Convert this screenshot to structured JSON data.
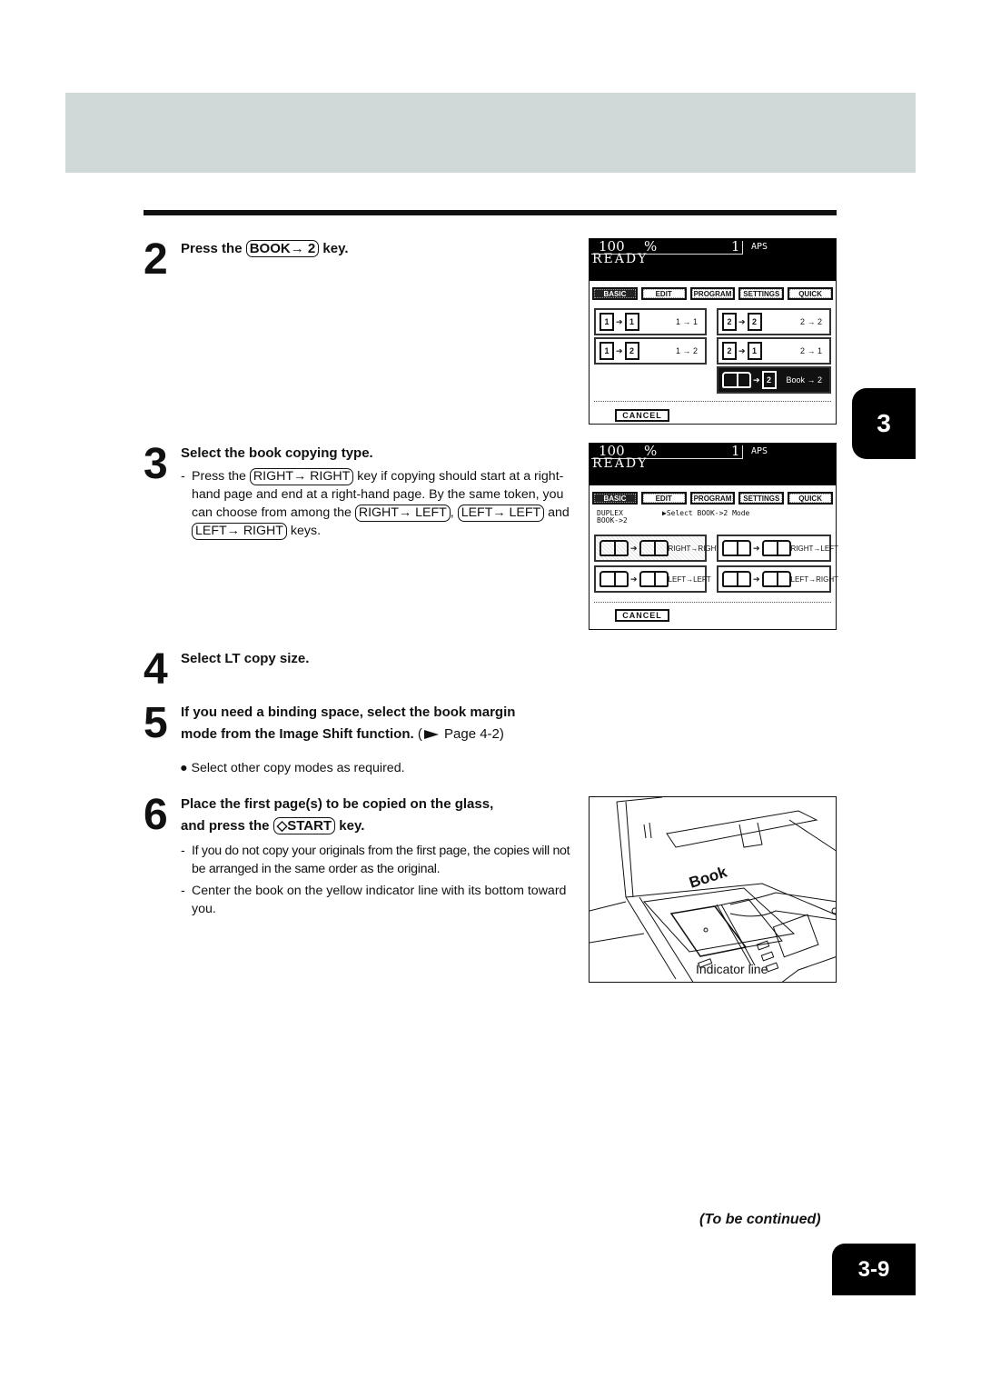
{
  "chapter_tab": "3",
  "steps": {
    "s2": {
      "num": "2",
      "title_pre": "Press the",
      "key": "BOOK→ 2",
      "title_post": "key."
    },
    "s3": {
      "num": "3",
      "title": "Select the book copying type.",
      "body_pre": "Press the",
      "key1": "RIGHT→ RIGHT",
      "body_mid1": "key if copying should start at a right-hand page and end at a right-hand page. By the same token, you can choose from among the",
      "key2": "RIGHT→ LEFT",
      "comma": ",",
      "key3": "LEFT→ LEFT",
      "and": "and",
      "key4": "LEFT→ RIGHT",
      "body_end": "keys."
    },
    "s4": {
      "num": "4",
      "title": "Select LT copy size."
    },
    "s5": {
      "num": "5",
      "title_line1": "If you need a binding space, select the book margin",
      "title_line2": "mode from the Image Shift function.",
      "ref_pre": "(",
      "ref": "Page 4-2)",
      "bullet": "Select other copy modes as required."
    },
    "s6": {
      "num": "6",
      "title_line1": "Place the first page(s) to be copied on the glass,",
      "title_pre": "and press the",
      "key": "◇START",
      "title_post": "key.",
      "notes": [
        "If you do not copy your originals from the first page, the copies will not be arranged in the same order as the original.",
        "Center the book on the yellow indicator line with its bottom toward you."
      ]
    }
  },
  "panel1": {
    "zoom": "100",
    "pct": "%",
    "copies": "1",
    "aps": "APS",
    "status": "READY",
    "tabs": [
      "BASIC",
      "EDIT",
      "PROGRAM",
      "SETTINGS",
      "QUICK"
    ],
    "active_tab": "BASIC",
    "modes": [
      {
        "from": "1",
        "to": "1",
        "label": "1 → 1"
      },
      {
        "from": "2",
        "to": "2",
        "label": "2 → 2"
      },
      {
        "from": "1",
        "to": "2",
        "label": "1 → 2"
      },
      {
        "from": "2",
        "to": "1",
        "label": "2 → 1"
      },
      {
        "from": "book",
        "to": "2",
        "label": "Book → 2",
        "selected": true
      }
    ],
    "cancel": "CANCEL"
  },
  "panel2": {
    "zoom": "100",
    "pct": "%",
    "copies": "1",
    "aps": "APS",
    "status": "READY",
    "tabs": [
      "BASIC",
      "EDIT",
      "PROGRAM",
      "SETTINGS",
      "QUICK"
    ],
    "active_tab": "BASIC",
    "mode_line1": "DUPLEX",
    "mode_line2": "BOOK->2",
    "message": "▶Select BOOK->2 Mode",
    "options": [
      {
        "label": "RIGHT→RIGHT",
        "selected": true
      },
      {
        "label": "RIGHT→LEFT"
      },
      {
        "label": "LEFT→LEFT"
      },
      {
        "label": "LEFT→RIGHT"
      }
    ],
    "cancel": "CANCEL"
  },
  "illustration": {
    "book_label": "Book",
    "indicator_label": "Indicator line"
  },
  "continued": "(To be continued)",
  "page_number": "3-9",
  "colors": {
    "header_band": "#cfd9d7",
    "ink": "#111111"
  }
}
